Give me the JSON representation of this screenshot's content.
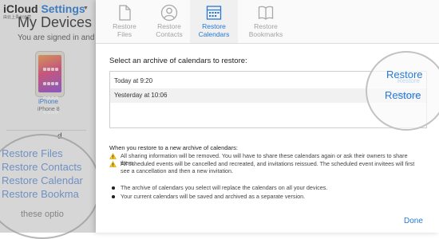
{
  "background": {
    "brand_name": "iCloud",
    "brand_accent": "Settings",
    "brand_subtitle": "由云上贵州运营",
    "title_fragment": "My Devices",
    "signed_in_fragment": "You are signed in and ru",
    "device_name": "iPhone",
    "device_model": "iPhone 8",
    "heading_fragment": "d",
    "links": [
      "Restore Files",
      "Restore Contacts",
      "Restore Calendar",
      "Restore Bookma"
    ],
    "options_fragment": "these optio"
  },
  "tabs": [
    {
      "label": "Restore\nFiles",
      "icon": "file-icon",
      "active": false
    },
    {
      "label": "Restore\nContacts",
      "icon": "contacts-icon",
      "active": false
    },
    {
      "label": "Restore\nCalendars",
      "icon": "calendar-icon",
      "active": true
    },
    {
      "label": "Restore\nBookmarks",
      "icon": "bookmarks-icon",
      "active": false
    }
  ],
  "prompt": "Select an archive of calendars to restore:",
  "archives": [
    {
      "when": "Today at 9:20",
      "action": "Restore"
    },
    {
      "when": "Yesterday at 10:06",
      "action": "Restore"
    }
  ],
  "notes_title": "When you restore to a new archive of calendars:",
  "notes": [
    {
      "kind": "warning",
      "text": "All sharing information will be removed. You will have to share these calendars again or ask their owners to share them."
    },
    {
      "kind": "warning",
      "text": "All scheduled events will be cancelled and recreated, and invitations reissued. The scheduled event invitees will first see a cancellation and then a new invitation."
    },
    {
      "kind": "bullet",
      "text": "The archive of calendars you select will replace the calendars on all your devices."
    },
    {
      "kind": "bullet",
      "text": "Your current calendars will be saved and archived as a separate version."
    }
  ],
  "done_label": "Done",
  "colors": {
    "accent": "#2779d6",
    "warning": "#f0c419"
  }
}
